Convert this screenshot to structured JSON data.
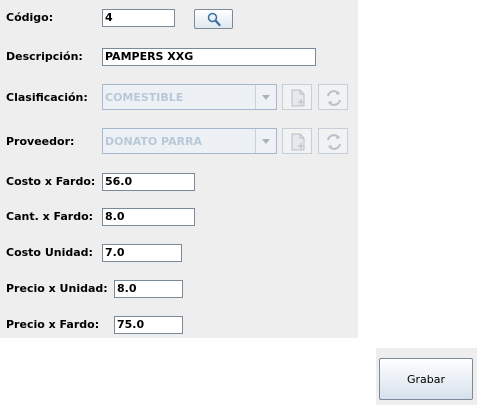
{
  "form": {
    "codigo": {
      "label": "Código:",
      "value": "4"
    },
    "descripcion": {
      "label": "Descripción:",
      "value": "PAMPERS XXG"
    },
    "clasificacion": {
      "label": "Clasificación:",
      "value": "COMESTIBLE"
    },
    "proveedor": {
      "label": "Proveedor:",
      "value": "DONATO PARRA"
    },
    "costo_fardo": {
      "label": "Costo x Fardo:",
      "value": "56.0"
    },
    "cant_fardo": {
      "label": "Cant. x Fardo:",
      "value": "8.0"
    },
    "costo_unidad": {
      "label": "Costo Unidad:",
      "value": "7.0"
    },
    "precio_unidad": {
      "label": "Precio x Unidad:",
      "value": "8.0"
    },
    "precio_fardo": {
      "label": "Precio x Fardo:",
      "value": "75.0"
    }
  },
  "buttons": {
    "grabar": "Grabar"
  },
  "icons": {
    "search": "magnifier-icon",
    "new": "new-document-icon",
    "refresh": "refresh-icon"
  },
  "colors": {
    "panel_bg": "#eeeeee",
    "disabled_text": "#b8c8d8",
    "field_border": "#7a8a99"
  }
}
